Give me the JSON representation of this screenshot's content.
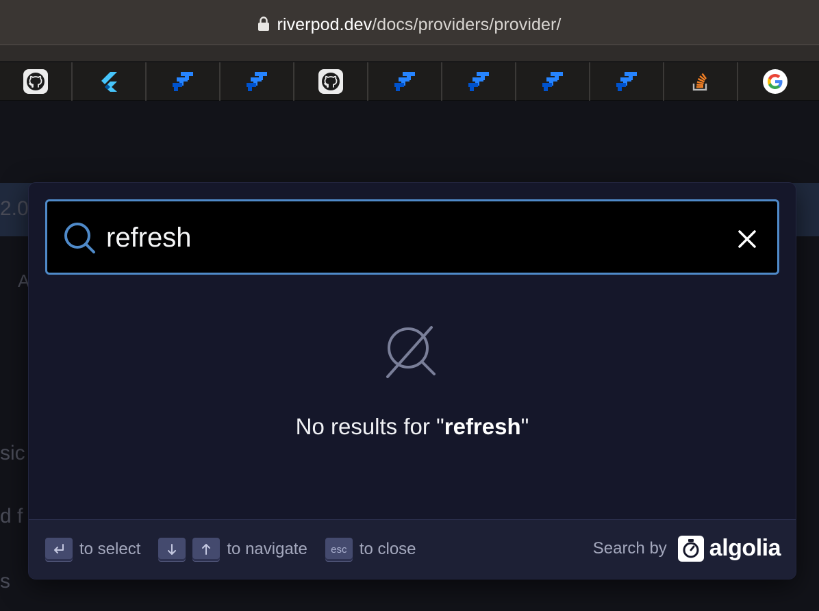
{
  "browser": {
    "url_host": "riverpod.dev",
    "url_path": "/docs/providers/provider/",
    "favorites": [
      {
        "name": "github",
        "icon": "github-icon"
      },
      {
        "name": "flutter",
        "icon": "flutter-icon"
      },
      {
        "name": "jira-1",
        "icon": "jira-icon"
      },
      {
        "name": "jira-2",
        "icon": "jira-icon"
      },
      {
        "name": "github-2",
        "icon": "github-icon"
      },
      {
        "name": "jira-3",
        "icon": "jira-icon"
      },
      {
        "name": "jira-4",
        "icon": "jira-icon"
      },
      {
        "name": "jira-5",
        "icon": "jira-icon"
      },
      {
        "name": "jira-6",
        "icon": "jira-icon"
      },
      {
        "name": "stackoverflow",
        "icon": "stackoverflow-icon"
      },
      {
        "name": "google",
        "icon": "google-icon"
      }
    ]
  },
  "background": {
    "band_text": "2.0",
    "text_1": "A",
    "text_2": "sic",
    "text_3": "d f",
    "text_4": "s"
  },
  "search": {
    "query": "refresh",
    "no_results_prefix": "No results for \"",
    "no_results_query": "refresh",
    "no_results_suffix": "\""
  },
  "footer": {
    "select_label": "to select",
    "navigate_label": "to navigate",
    "close_label": "to close",
    "esc_key": "esc",
    "search_by_label": "Search by",
    "brand": "algolia"
  },
  "colors": {
    "accent": "#4f8ac9",
    "modal_bg": "#15172a",
    "footer_bg": "#1d2035"
  }
}
